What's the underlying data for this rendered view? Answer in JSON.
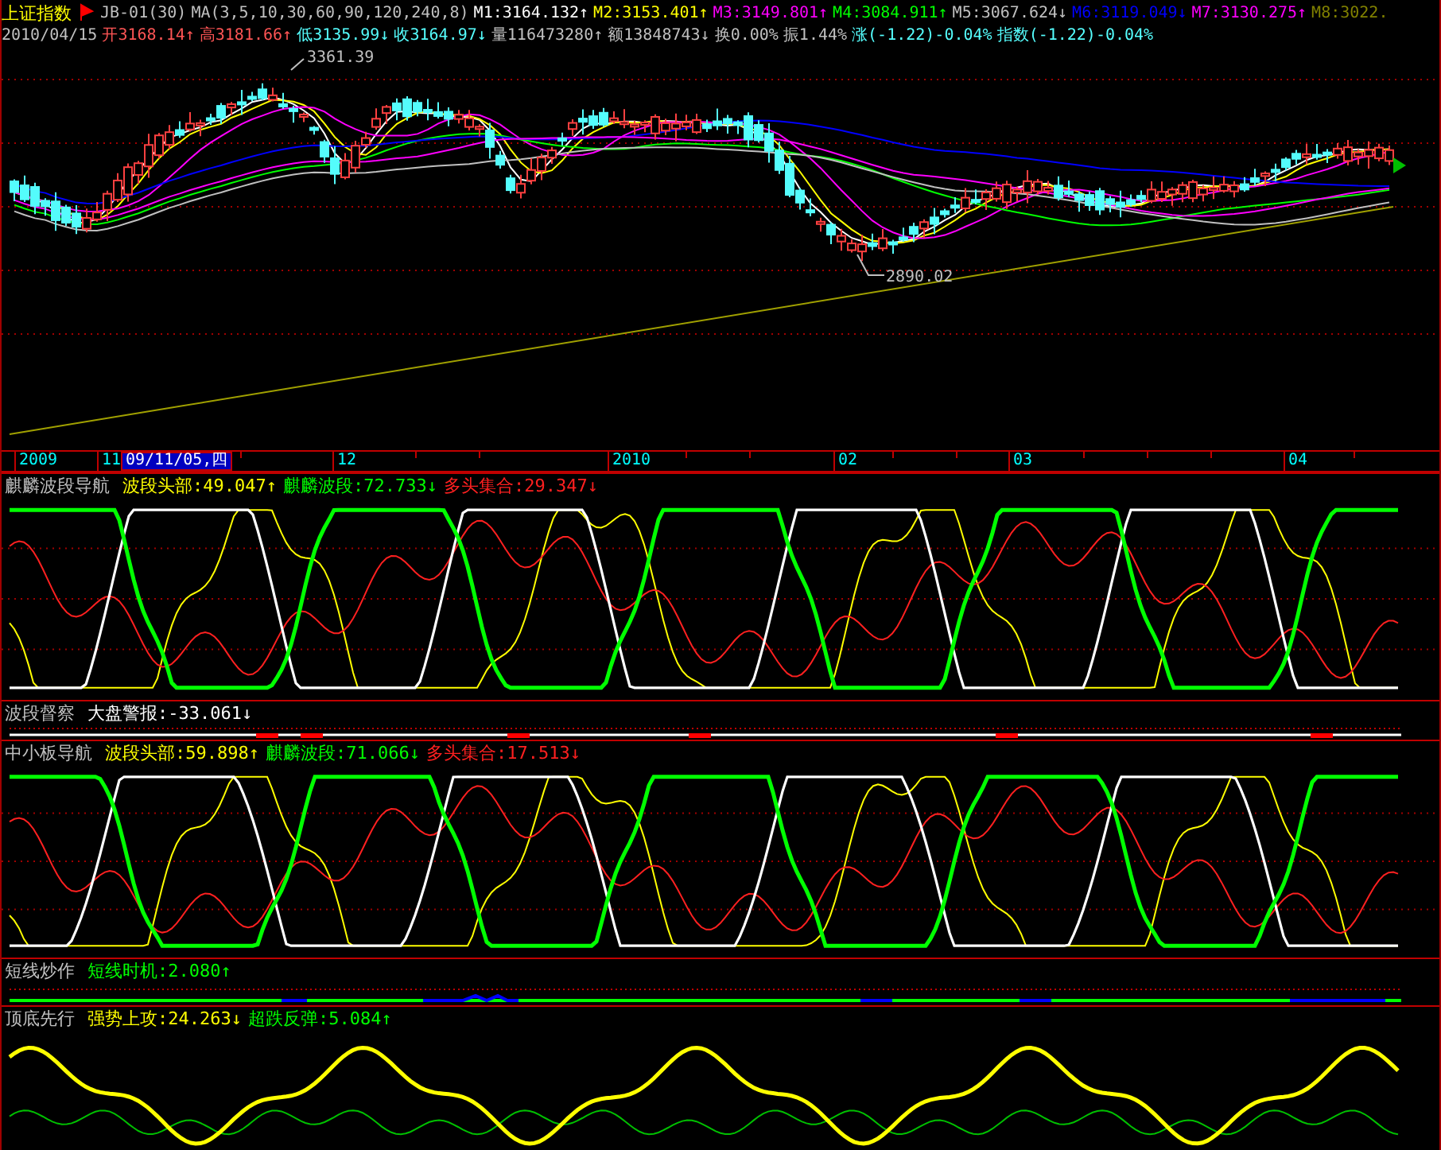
{
  "main_panel": {
    "title": "上证指数",
    "indicator": "JB-01(30)",
    "ma_params": "MA(3,5,10,30,60,90,120,240,8)",
    "ma_values": [
      {
        "text": "M1:3164.132",
        "arrow": "↑",
        "color": "#ffffff"
      },
      {
        "text": "M2:3153.401",
        "arrow": "↑",
        "color": "#ffff00"
      },
      {
        "text": "M3:3149.801",
        "arrow": "↑",
        "color": "#ff00ff"
      },
      {
        "text": "M4:3084.911",
        "arrow": "↑",
        "color": "#00ff00"
      },
      {
        "text": "M5:3067.624",
        "arrow": "↓",
        "color": "#c0c0c0"
      },
      {
        "text": "M6:3119.049",
        "arrow": "↓",
        "color": "#0000ff"
      },
      {
        "text": "M7:3130.275",
        "arrow": "↑",
        "color": "#ff00ff"
      },
      {
        "text": "M8:3022.",
        "color": "#808000"
      }
    ],
    "quote_date": "2010/04/15",
    "quote_items": [
      {
        "text": "开3168.14",
        "arrow": "↑",
        "color": "#ff5555"
      },
      {
        "text": "高3181.66",
        "arrow": "↑",
        "color": "#ff5555"
      },
      {
        "text": "低3135.99",
        "arrow": "↓",
        "color": "#55ffff"
      },
      {
        "text": "收3164.97",
        "arrow": "↓",
        "color": "#55ffff"
      },
      {
        "text": "量116473280",
        "arrow": "↑",
        "color": "#c0c0c0"
      },
      {
        "text": "额13848743",
        "arrow": "↓",
        "color": "#c0c0c0"
      },
      {
        "text": "换0.00%",
        "color": "#c0c0c0"
      },
      {
        "text": "振1.44%",
        "color": "#c0c0c0"
      },
      {
        "text": "涨(-1.22)-0.04%",
        "color": "#55ffff"
      },
      {
        "text": "指数(-1.22)-0.04%",
        "color": "#55ffff"
      }
    ],
    "annotations": [
      {
        "text": "3361.39"
      },
      {
        "text": "2890.02"
      }
    ]
  },
  "time_axis": {
    "labels": [
      {
        "text": "2009",
        "selected": false
      },
      {
        "text": "11",
        "selected": false
      },
      {
        "text": "09/11/05,四",
        "selected": true
      },
      {
        "text": "12",
        "selected": false
      },
      {
        "text": "2010",
        "selected": false
      },
      {
        "text": "02",
        "selected": false
      },
      {
        "text": "03",
        "selected": false
      },
      {
        "text": "04",
        "selected": false
      }
    ]
  },
  "panels": [
    {
      "kind": "oscillator",
      "title": "麒麟波段导航",
      "values": [
        {
          "text": "波段头部:49.047",
          "arrow": "↑",
          "color": "#ffff00"
        },
        {
          "text": "麒麟波段:72.733",
          "arrow": "↓",
          "color": "#00ff00"
        },
        {
          "text": "多头集合:29.347",
          "arrow": "↓",
          "color": "#ff2020"
        }
      ]
    },
    {
      "kind": "alert",
      "title": "波段督察",
      "values": [
        {
          "text": "大盘警报:-33.061",
          "arrow": "↓",
          "color": "#ffffff"
        }
      ]
    },
    {
      "kind": "oscillator",
      "title": "中小板导航",
      "values": [
        {
          "text": "波段头部:59.898",
          "arrow": "↑",
          "color": "#ffff00"
        },
        {
          "text": "麒麟波段:71.066",
          "arrow": "↓",
          "color": "#00ff00"
        },
        {
          "text": "多头集合:17.513",
          "arrow": "↓",
          "color": "#ff2020"
        }
      ]
    },
    {
      "kind": "signal",
      "title": "短线炒作",
      "values": [
        {
          "text": "短线时机:2.080",
          "arrow": "↑",
          "color": "#00ff00"
        }
      ]
    },
    {
      "kind": "trend",
      "title": "顶底先行",
      "values": [
        {
          "text": "强势上攻:24.263",
          "arrow": "↓",
          "color": "#ffff00"
        },
        {
          "text": "超跌反弹:5.084",
          "arrow": "↑",
          "color": "#00ff00"
        }
      ]
    }
  ]
}
